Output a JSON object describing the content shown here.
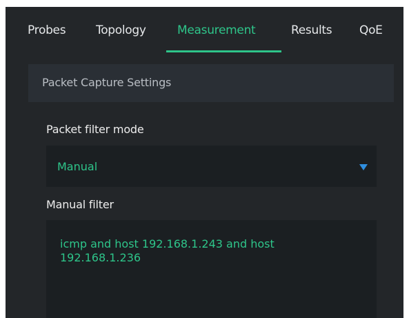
{
  "tabs": [
    {
      "label": "Probes"
    },
    {
      "label": "Topology"
    },
    {
      "label": "Measurement",
      "active": true
    },
    {
      "label": "Results"
    },
    {
      "label": "QoE"
    }
  ],
  "section": {
    "title": "Packet Capture Settings"
  },
  "packet_filter_mode": {
    "label": "Packet filter mode",
    "value": "Manual",
    "arrow_icon": "triangle-down-icon"
  },
  "manual_filter": {
    "label": "Manual filter",
    "value": "icmp and host 192.168.1.243 and host\n192.168.1.236"
  },
  "colors": {
    "accent": "#2ec58a",
    "dropdown_arrow": "#2f8fe0",
    "background": "#232629",
    "field_background": "#1b1f22",
    "header_background": "#2a2f35"
  }
}
